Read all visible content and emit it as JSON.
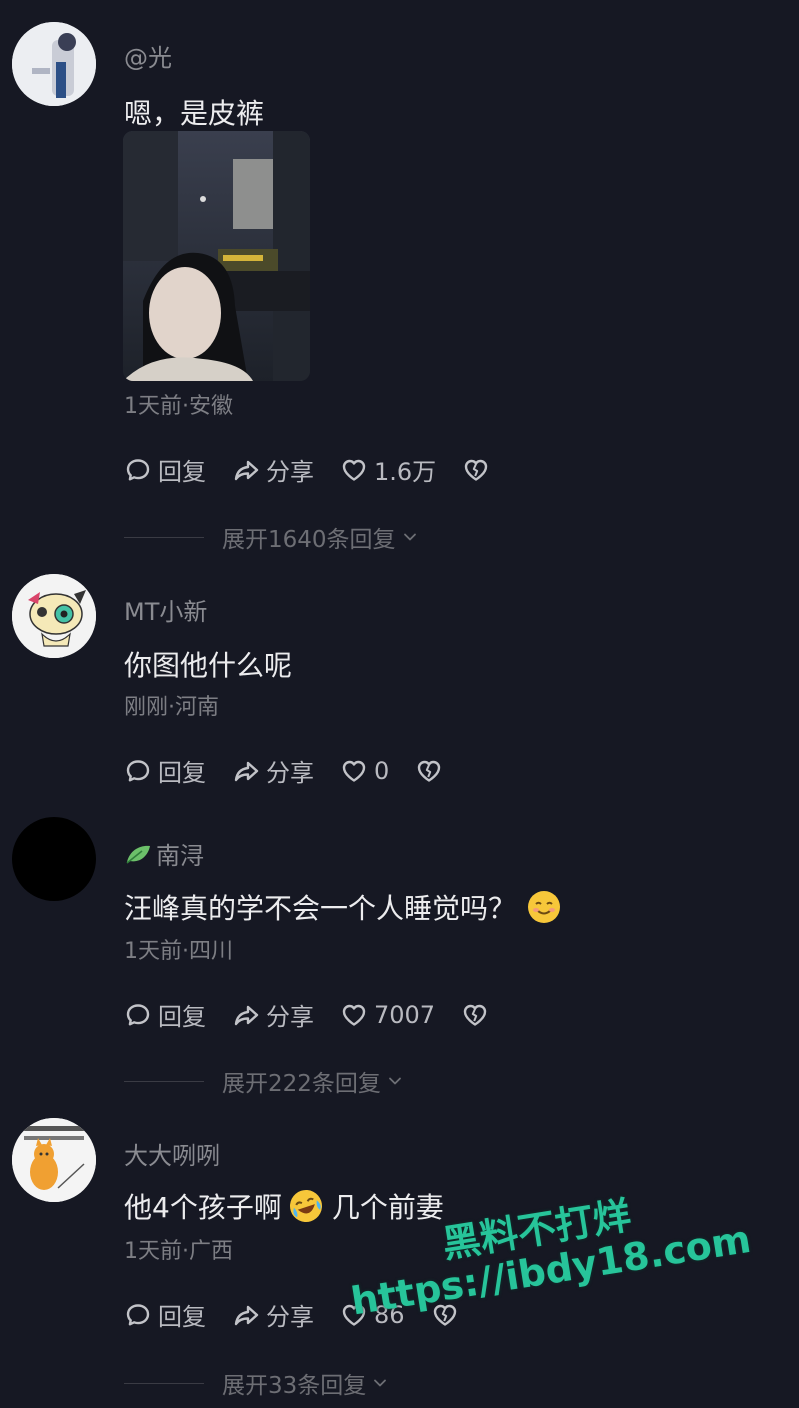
{
  "comments": [
    {
      "username": "@光",
      "text": "嗯，是皮裤",
      "meta": "1天前·安徽",
      "reply": "回复",
      "share": "分享",
      "likes": "1.6万",
      "expand": "展开1640条回复"
    },
    {
      "username": "MT小新",
      "text": "你图他什么呢",
      "meta": "刚刚·河南",
      "reply": "回复",
      "share": "分享",
      "likes": "0"
    },
    {
      "username": "南浔",
      "text": "汪峰真的学不会一个人睡觉吗？",
      "meta": "1天前·四川",
      "reply": "回复",
      "share": "分享",
      "likes": "7007",
      "expand": "展开222条回复"
    },
    {
      "username": "大大咧咧",
      "text_a": "他4个孩子啊",
      "text_b": "几个前妻",
      "meta": "1天前·广西",
      "reply": "回复",
      "share": "分享",
      "likes": "86",
      "expand": "展开33条回复"
    }
  ],
  "watermark": {
    "line1": "黑料不打烊",
    "line2": "https://ibdy18.com"
  },
  "colors": {
    "background": "#161823",
    "watermark": "#27c49a"
  },
  "icons": [
    "comment-bubble-icon",
    "share-arrow-icon",
    "heart-icon",
    "broken-heart-icon",
    "chevron-down-icon",
    "leaf-icon",
    "smile-emoji-icon",
    "laugh-cry-emoji-icon"
  ]
}
